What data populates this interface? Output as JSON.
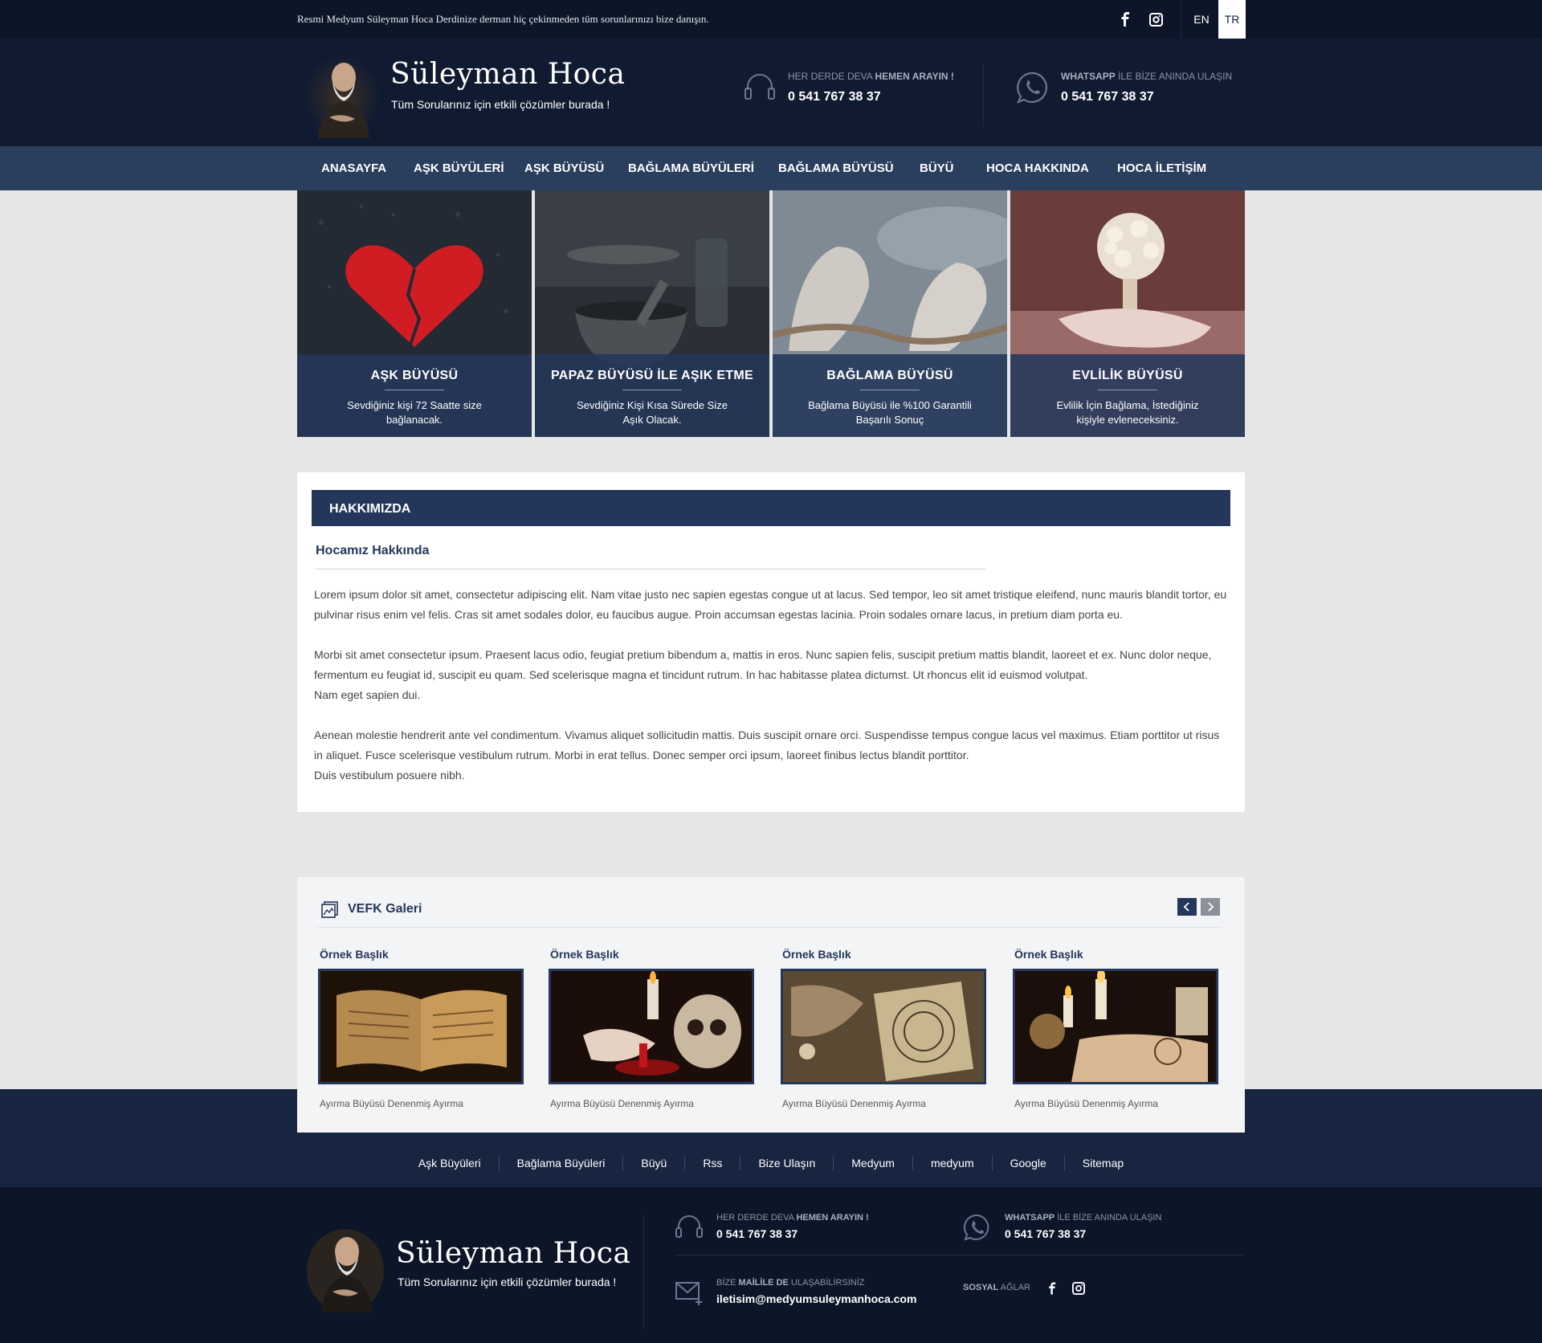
{
  "topbar": {
    "message": "Resmi Medyum Süleyman Hoca Derdinize derman hiç çekinmeden tüm sorunlarınızı bize danışın.",
    "social_icons": [
      "facebook-icon",
      "instagram-icon"
    ],
    "lang_en": "EN",
    "lang_tr": "TR"
  },
  "header": {
    "brand_title": "Süleyman Hoca",
    "brand_subtitle": "Tüm Sorularınız için etkili çözümler burada !",
    "phone": {
      "caption_pre": "HER DERDE DEVA ",
      "caption_bold": "HEMEN ARAYIN !",
      "number": "0 541 767 38 37"
    },
    "whatsapp": {
      "caption_bold": "WHATSAPP",
      "caption_post": " İLE BİZE ANINDA ULAŞIN",
      "number": "0 541 767 38 37"
    }
  },
  "nav": [
    "ANASAYFA",
    "AŞK BÜYÜLERİ",
    "AŞK BÜYÜSÜ",
    "BAĞLAMA BÜYÜLERİ",
    "BAĞLAMA BÜYÜSÜ",
    "BÜYÜ",
    "HOCA HAKKINDA",
    "HOCA İLETİŞİM"
  ],
  "tiles": [
    {
      "title": "AŞK BÜYÜSÜ",
      "desc": "Sevdiğiniz kişi 72 Saatte size bağlanacak."
    },
    {
      "title": "PAPAZ BÜYÜSÜ İLE AŞIK ETME",
      "desc": "Sevdiğiniz Kişi Kısa Sürede Size Aşık Olacak."
    },
    {
      "title": "BAĞLAMA BÜYÜSÜ",
      "desc": "Bağlama Büyüsü ile %100 Garantili Başarılı Sonuç"
    },
    {
      "title": "EVLİLİK BÜYÜSÜ",
      "desc": "Evlilik İçin Bağlama, İstediğiniz kişiyle evleneceksiniz."
    }
  ],
  "about": {
    "heading": "HAKKIMIZDA",
    "subheading": "Hocamız Hakkında",
    "paragraphs": [
      "Lorem ipsum dolor sit amet, consectetur adipiscing elit. Nam vitae justo nec sapien egestas congue ut at lacus. Sed tempor, leo sit amet tristique eleifend, nunc mauris blandit tortor, eu pulvinar risus enim vel felis. Cras sit amet sodales dolor, eu faucibus augue. Proin accumsan egestas lacinia. Proin sodales ornare lacus, in pretium diam porta eu.",
      "Morbi sit amet consectetur ipsum. Praesent lacus odio, feugiat pretium bibendum a, mattis in eros. Nunc sapien felis, suscipit pretium mattis blandit, laoreet et ex. Nunc dolor neque, fermentum eu feugiat id, suscipit eu quam. Sed scelerisque magna et tincidunt rutrum. In hac habitasse platea dictumst. Ut rhoncus elit id euismod volutpat.",
      "Nam eget sapien dui.",
      "Aenean molestie hendrerit ante vel condimentum. Vivamus aliquet sollicitudin mattis. Duis suscipit ornare orci. Suspendisse tempus congue lacus vel maximus. Etiam porttitor ut risus in aliquet. Fusce scelerisque vestibulum rutrum. Morbi in erat tellus. Donec semper orci ipsum, laoreet finibus lectus blandit porttitor.",
      "Duis vestibulum posuere nibh."
    ]
  },
  "gallery": {
    "title": "VEFK Galeri",
    "items": [
      {
        "title": "Örnek Başlık",
        "caption": "Ayırma Büyüsü Denenmiş Ayırma"
      },
      {
        "title": "Örnek Başlık",
        "caption": "Ayırma Büyüsü Denenmiş Ayırma"
      },
      {
        "title": "Örnek Başlık",
        "caption": "Ayırma Büyüsü Denenmiş Ayırma"
      },
      {
        "title": "Örnek Başlık",
        "caption": "Ayırma Büyüsü Denenmiş Ayırma"
      }
    ]
  },
  "footer_links": [
    "Aşk  Büyüleri",
    "Bağlama  Büyüleri",
    "Büyü",
    "Rss",
    "Bize  Ulaşın",
    "Medyum",
    "medyum",
    "Google",
    "Sitemap"
  ],
  "footer": {
    "brand_title": "Süleyman Hoca",
    "brand_subtitle": "Tüm Sorularınız için etkili çözümler burada !",
    "phone": {
      "caption_pre": "HER DERDE DEVA ",
      "caption_bold": "HEMEN ARAYIN !",
      "number": "0 541 767 38 37"
    },
    "whatsapp": {
      "caption_bold": "WHATSAPP",
      "caption_post": " İLE BİZE ANINDA ULAŞIN",
      "number": "0 541 767 38 37"
    },
    "mail": {
      "caption_pre": "BİZE ",
      "caption_bold": "MAİLİLE DE",
      "caption_post": " ULAŞABİLİRSİNİZ",
      "address": "iletisim@medyumsuleymanhoca.com"
    },
    "social_bold": "SOSYAL",
    "social_post": " AĞLAR"
  },
  "colors": {
    "navy_dark": "#0c1628",
    "navy": "#101b31",
    "nav": "#2a3e5e",
    "accent": "#24375a"
  }
}
